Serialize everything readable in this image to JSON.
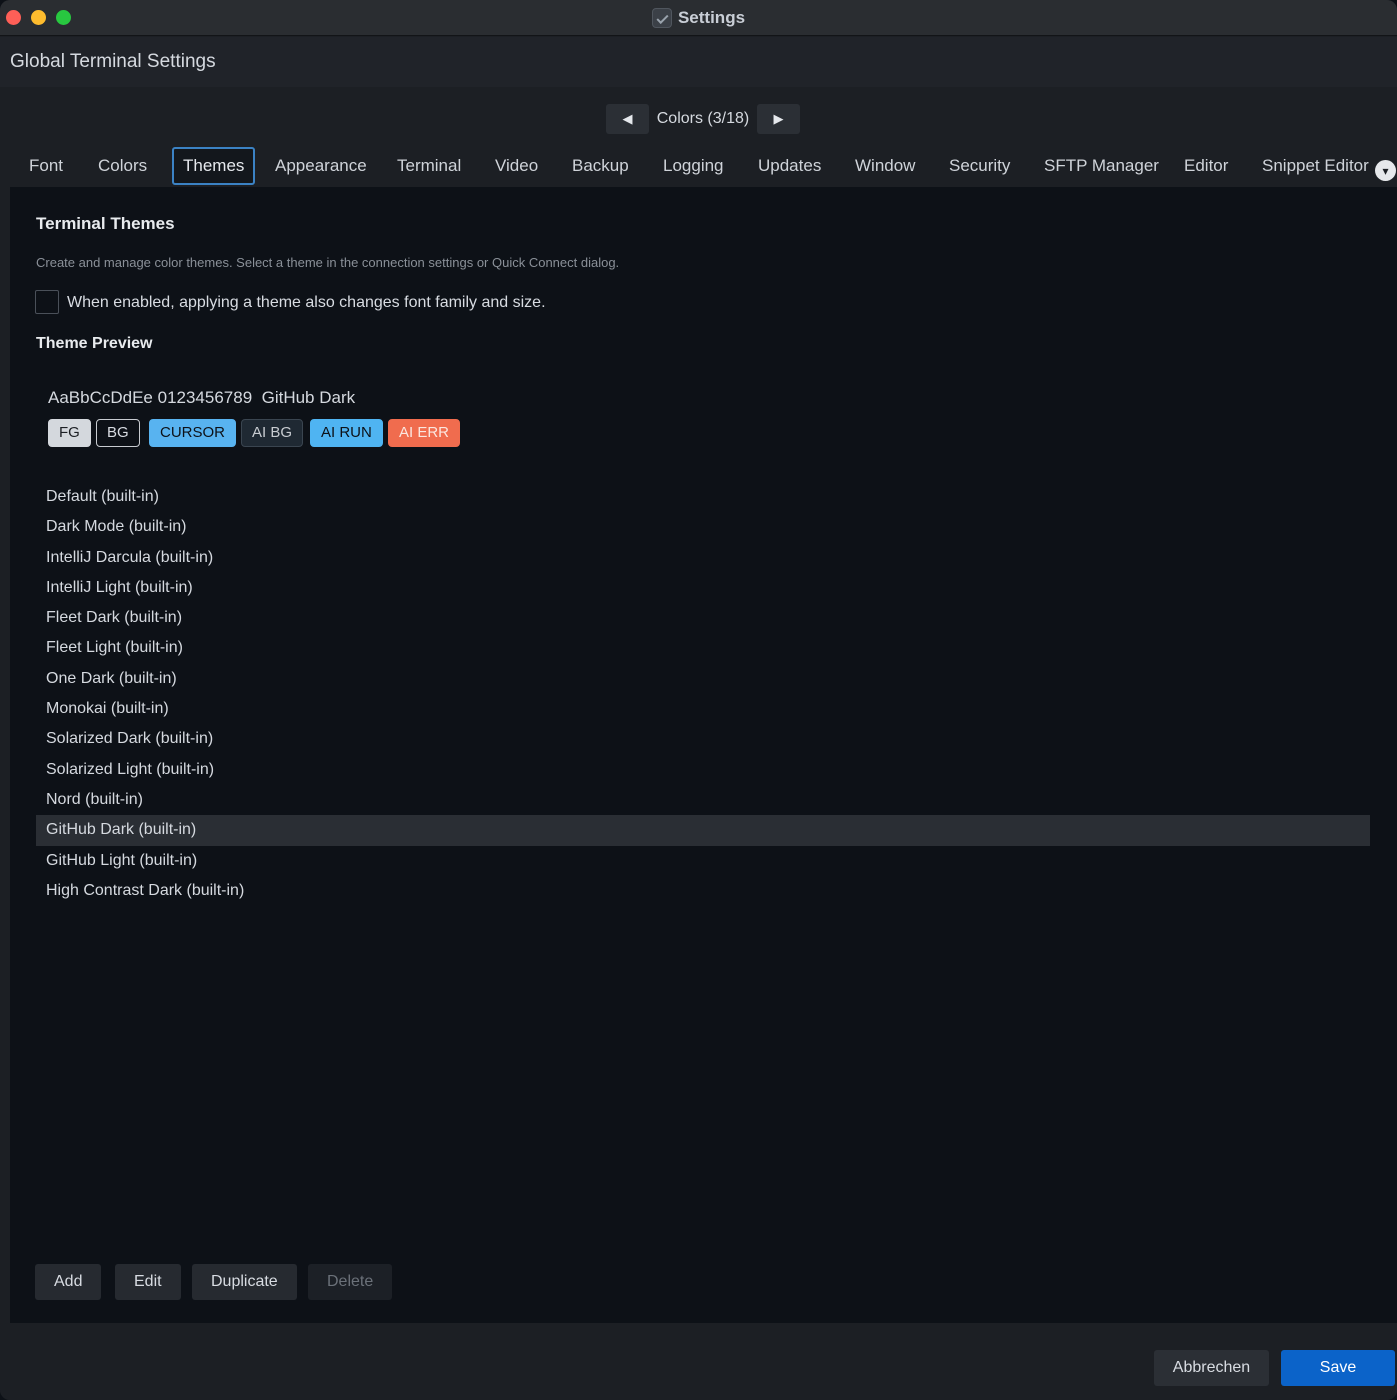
{
  "window": {
    "title": "Settings",
    "controls": [
      "close",
      "minimize",
      "maximize"
    ]
  },
  "header": {
    "title": "Global Terminal Settings"
  },
  "page_nav": {
    "label": "Colors (3/18)",
    "prev_icon": "triangle-left-icon",
    "next_icon": "triangle-right-icon",
    "prev_glyph": "◀",
    "next_glyph": "▶"
  },
  "tabs": [
    {
      "label": "Font"
    },
    {
      "label": "Colors"
    },
    {
      "label": "Themes",
      "active": true
    },
    {
      "label": "Appearance"
    },
    {
      "label": "Terminal"
    },
    {
      "label": "Video"
    },
    {
      "label": "Backup"
    },
    {
      "label": "Logging"
    },
    {
      "label": "Updates"
    },
    {
      "label": "Window"
    },
    {
      "label": "Security"
    },
    {
      "label": "SFTP Manager"
    },
    {
      "label": "Editor"
    },
    {
      "label": "Snippet Editor"
    }
  ],
  "tabs_more_glyph": "▾",
  "themes_page": {
    "title": "Terminal Themes",
    "description": "Create and manage color themes. Select a theme in the connection settings or Quick Connect dialog.",
    "font_checkbox": {
      "checked": false,
      "label": "When enabled, applying a theme also changes font family and size."
    },
    "preview_title": "Theme Preview",
    "preview": {
      "sample_text": "AaBbCcDdEe 0123456789  GitHub Dark",
      "swatches": [
        {
          "label": "FG",
          "color": "#d4d8dd"
        },
        {
          "label": "BG",
          "color": "#0d1117"
        },
        {
          "label": "CURSOR",
          "color": "#58b3f0"
        },
        {
          "label": "AI BG",
          "color": "#1f2933"
        },
        {
          "label": "AI RUN",
          "color": "#4fb4f2"
        },
        {
          "label": "AI ERR",
          "color": "#f06c4e"
        }
      ]
    },
    "themes": [
      {
        "name": "Default (built-in)"
      },
      {
        "name": "Dark Mode (built-in)"
      },
      {
        "name": "IntelliJ Darcula (built-in)"
      },
      {
        "name": "IntelliJ Light (built-in)"
      },
      {
        "name": "Fleet Dark (built-in)"
      },
      {
        "name": "Fleet Light (built-in)"
      },
      {
        "name": "One Dark (built-in)"
      },
      {
        "name": "Monokai (built-in)"
      },
      {
        "name": "Solarized Dark (built-in)"
      },
      {
        "name": "Solarized Light (built-in)"
      },
      {
        "name": "Nord (built-in)"
      },
      {
        "name": "GitHub Dark (built-in)",
        "selected": true
      },
      {
        "name": "GitHub Light (built-in)"
      },
      {
        "name": "High Contrast Dark (built-in)"
      }
    ],
    "actions": {
      "add": "Add",
      "edit": "Edit",
      "duplicate": "Duplicate",
      "delete": "Delete",
      "delete_enabled": false
    }
  },
  "footer": {
    "cancel": "Abbrechen",
    "save": "Save"
  },
  "colors": {
    "accent": "#0b63c9",
    "tab_focus": "#3b82c4",
    "content_bg": "#0d1117"
  }
}
